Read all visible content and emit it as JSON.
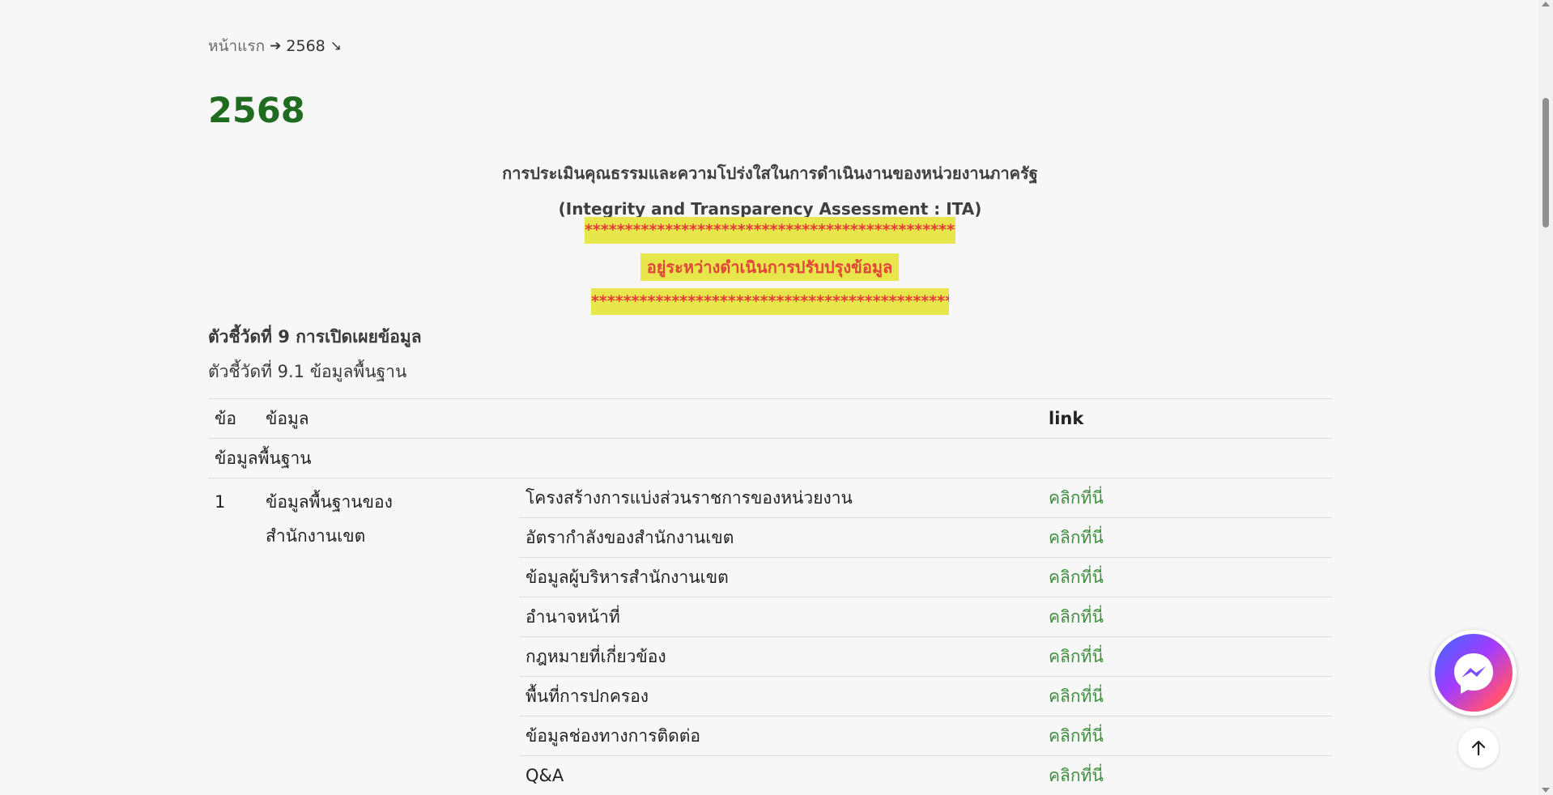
{
  "breadcrumb": {
    "home": "หน้าแรก",
    "separator": "➔",
    "current": "2568",
    "current_icon": "↘"
  },
  "page_title": "2568",
  "heading_th": "การประเมินคุณธรรมและความโปร่งใสในการดำเนินงานของหน่วยงานภาครัฐ",
  "heading_en": "(Integrity and Transparency Assessment : ITA)",
  "stars_line_1": "********************************************************",
  "status_note": "อยู่ระหว่างดำเนินการปรับปรุงข้อมูล",
  "stars_line_2": "********************************************************",
  "indicator_title": "ตัวชี้วัดที่ 9 การเปิดเผยข้อมูล",
  "indicator_sub": "ตัวชี้วัดที่ 9.1 ข้อมูลพื้นฐาน",
  "table": {
    "headers": {
      "no": "ข้อ",
      "info": "ข้อมูล",
      "link": "link"
    },
    "section": "ข้อมูลพื้นฐาน",
    "group_no": "1",
    "group_topic_line1": "ข้อมูลพื้นฐานของ",
    "group_topic_line2": "สำนักงานเขต",
    "rows": [
      {
        "item": "โครงสร้างการแบ่งส่วนราชการของหน่วยงาน",
        "link": "คลิกที่นี่"
      },
      {
        "item": "อัตรากำลังของสำนักงานเขต",
        "link": "คลิกที่นี่"
      },
      {
        "item": "ข้อมูลผู้บริหารสำนักงานเขต",
        "link": "คลิกที่นี่"
      },
      {
        "item": "อำนาจหน้าที่",
        "link": "คลิกที่นี่"
      },
      {
        "item": "กฎหมายที่เกี่ยวข้อง",
        "link": "คลิกที่นี่"
      },
      {
        "item": "พื้นที่การปกครอง",
        "link": "คลิกที่นี่"
      },
      {
        "item": "ข้อมูลช่องทางการติดต่อ",
        "link": "คลิกที่นี่"
      },
      {
        "item": "Q&A",
        "link": "คลิกที่นี่"
      }
    ]
  },
  "colors": {
    "title_green": "#1f6b1f",
    "link_green": "#3f8f3f",
    "highlight_yellow": "#e7e64a",
    "highlight_red": "#e23b3b"
  },
  "icons": {
    "messenger": "messenger-icon",
    "scroll_top": "arrow-up-icon"
  }
}
